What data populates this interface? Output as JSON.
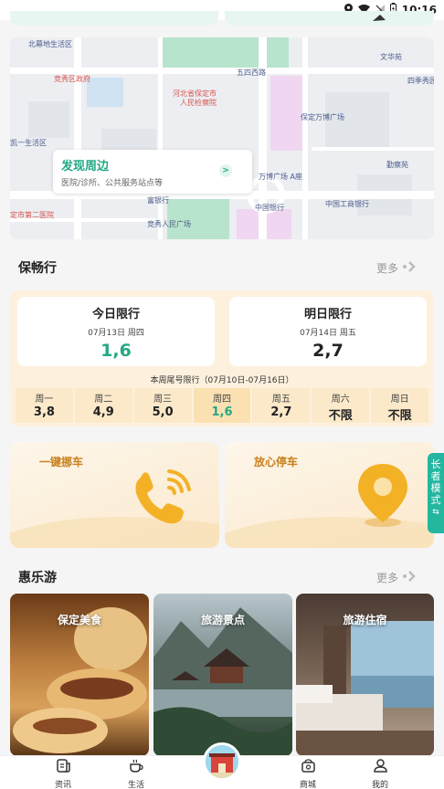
{
  "status_bar": {
    "time": "10:16"
  },
  "map": {
    "discover_title": "发现周边",
    "discover_subtitle": "医院/诊所、公共服务站点等",
    "discover_arrow": ">",
    "labels": [
      {
        "text": "北幕地生活区",
        "cls": ""
      },
      {
        "text": "竞秀区政府",
        "cls": "red"
      },
      {
        "text": "河北省保定市",
        "cls": "red"
      },
      {
        "text": "人民检察院",
        "cls": "red"
      },
      {
        "text": "五四西路",
        "cls": ""
      },
      {
        "text": "保定万博广场",
        "cls": ""
      },
      {
        "text": "文华苑",
        "cls": ""
      },
      {
        "text": "四季秀园",
        "cls": ""
      },
      {
        "text": "凯一生活区",
        "cls": ""
      },
      {
        "text": "万博广场 A座",
        "cls": ""
      },
      {
        "text": "勤察苑",
        "cls": ""
      },
      {
        "text": "定市第二医院",
        "cls": "red"
      },
      {
        "text": "富银行",
        "cls": ""
      },
      {
        "text": "竞秀人民广场",
        "cls": ""
      },
      {
        "text": "中国银行",
        "cls": ""
      },
      {
        "text": "中国工商银行",
        "cls": ""
      }
    ]
  },
  "baochangxing": {
    "title": "保畅行",
    "more": "更多",
    "today": {
      "title": "今日限行",
      "date": "07月13日 周四",
      "numbers": "1,6"
    },
    "tomorrow": {
      "title": "明日限行",
      "date": "07月14日 周五",
      "numbers": "2,7"
    },
    "week_caption": "本周尾号限行（07月10日-07月16日）",
    "week": [
      {
        "day": "周一",
        "value": "3,8"
      },
      {
        "day": "周二",
        "value": "4,9"
      },
      {
        "day": "周三",
        "value": "5,0"
      },
      {
        "day": "周四",
        "value": "1,6"
      },
      {
        "day": "周五",
        "value": "2,7"
      },
      {
        "day": "周六",
        "value": "不限"
      },
      {
        "day": "周日",
        "value": "不限"
      }
    ]
  },
  "services": {
    "move_car": "一键挪车",
    "parking": "放心停车"
  },
  "elder_mode": "长者模式",
  "huilvyou": {
    "title": "惠乐游",
    "more": "更多",
    "cards": [
      {
        "label": "保定美食"
      },
      {
        "label": "旅游景点"
      },
      {
        "label": "旅游住宿"
      }
    ]
  },
  "nav": {
    "news": "资讯",
    "life": "生活",
    "mall": "商城",
    "mine": "我的"
  },
  "colors": {
    "accent": "#23a884",
    "warm": "#c77f1c"
  }
}
